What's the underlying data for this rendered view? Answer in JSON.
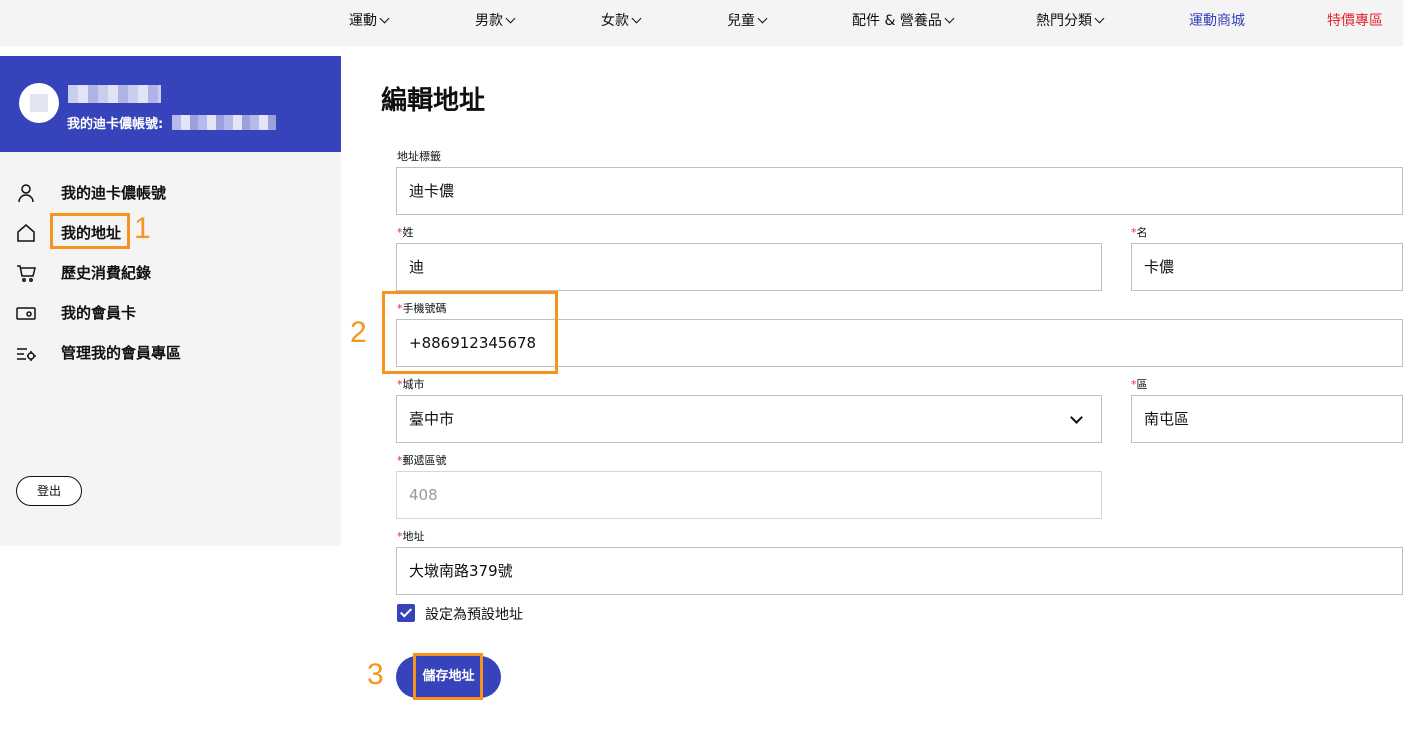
{
  "nav": {
    "items": [
      {
        "label": "運動"
      },
      {
        "label": "男款"
      },
      {
        "label": "女款"
      },
      {
        "label": "兒童"
      },
      {
        "label": "配件 & 營養品"
      },
      {
        "label": "熱門分類"
      },
      {
        "label": "運動商城"
      },
      {
        "label": "特價專區"
      }
    ]
  },
  "profile": {
    "account_label": "我的迪卡儂帳號:"
  },
  "sidebar": {
    "items": [
      {
        "label": "我的迪卡儂帳號",
        "icon": "user-icon"
      },
      {
        "label": "我的地址",
        "icon": "home-icon"
      },
      {
        "label": "歷史消費紀錄",
        "icon": "cart-icon"
      },
      {
        "label": "我的會員卡",
        "icon": "card-icon"
      },
      {
        "label": "管理我的會員專區",
        "icon": "settings-list-icon"
      }
    ],
    "logout_label": "登出"
  },
  "annotations": {
    "step1": "1",
    "step2": "2",
    "step3": "3",
    "color": "#f7931e"
  },
  "form": {
    "title": "編輯地址",
    "address_tag": {
      "label": "地址標籤",
      "value": "迪卡儂"
    },
    "last_name": {
      "required": "*",
      "label": "姓",
      "value": "迪"
    },
    "first_name": {
      "required": "*",
      "label": "名",
      "value": "卡儂"
    },
    "phone": {
      "required": "*",
      "label": "手機號碼",
      "value": "+886912345678"
    },
    "city": {
      "required": "*",
      "label": "城市",
      "value": "臺中市"
    },
    "district": {
      "required": "*",
      "label": "區",
      "value": "南屯區"
    },
    "postal_code": {
      "required": "*",
      "label": "郵遞區號",
      "value": "408"
    },
    "address": {
      "required": "*",
      "label": "地址",
      "value": "大墩南路379號"
    },
    "default_checkbox_label": "設定為預設地址",
    "default_checked": true,
    "save_label": "儲存地址"
  },
  "colors": {
    "brand": "#3643ba",
    "sale": "#e3262f",
    "highlight": "#f7931e"
  }
}
